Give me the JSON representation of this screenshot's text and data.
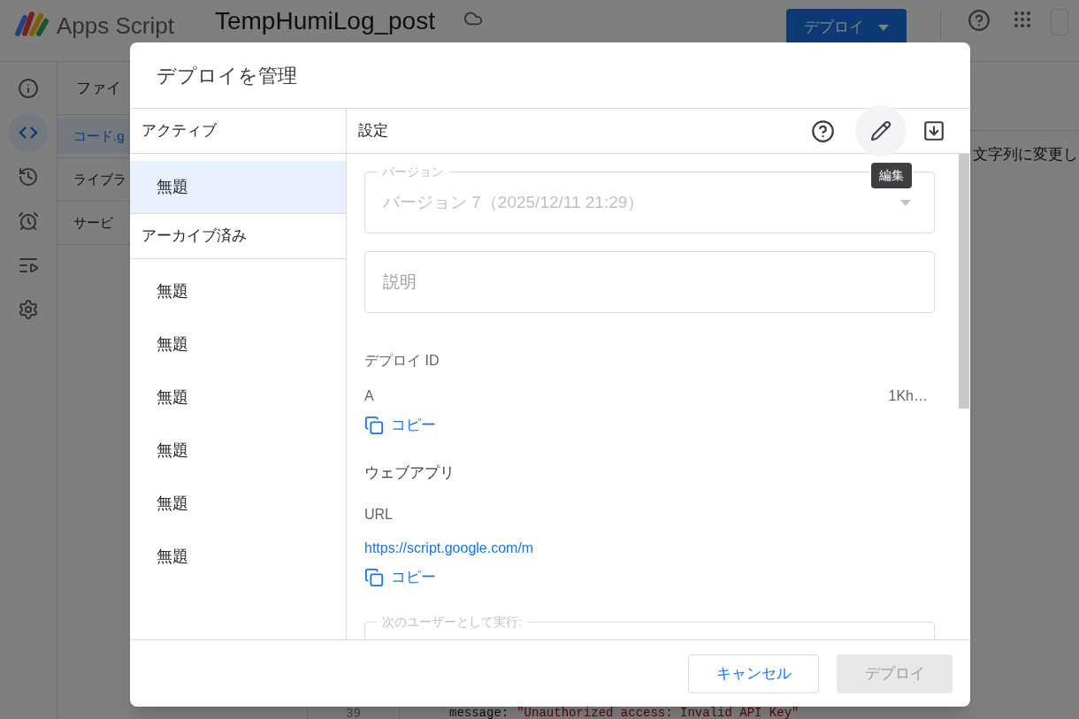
{
  "app_bar": {
    "product": "Apps Script",
    "project": "TempHumiLog_post",
    "deploy_button": "デプロイ"
  },
  "rail": [
    {
      "kind": "info",
      "selected": false
    },
    {
      "kind": "code",
      "selected": true
    },
    {
      "kind": "history",
      "selected": false
    },
    {
      "kind": "alarm",
      "selected": false
    },
    {
      "kind": "run",
      "selected": false
    },
    {
      "kind": "settings",
      "selected": false
    }
  ],
  "file_panel": {
    "heading": "ファイ",
    "items": [
      {
        "label": "コード.g",
        "selected": true
      },
      {
        "label": "ライブラ",
        "selected": false
      },
      {
        "label": "サービ",
        "selected": false
      }
    ]
  },
  "editor": {
    "text": "文字列に変更し",
    "line_number": "39",
    "code_key": "message:",
    "code_value": "\"Unauthorized access: Invalid API Key\""
  },
  "dialog": {
    "title": "デプロイを管理",
    "sections": [
      {
        "heading": "アクティブ",
        "items": [
          {
            "label": "無題",
            "selected": true
          }
        ]
      },
      {
        "heading": "アーカイブ済み",
        "items": [
          {
            "label": "無題",
            "selected": false
          },
          {
            "label": "無題",
            "selected": false
          },
          {
            "label": "無題",
            "selected": false
          },
          {
            "label": "無題",
            "selected": false
          },
          {
            "label": "無題",
            "selected": false
          },
          {
            "label": "無題",
            "selected": false
          }
        ]
      }
    ],
    "settings": {
      "heading": "設定",
      "tooltip": "編集",
      "version": {
        "label": "バージョン",
        "value": "バージョン 7（2025/12/11 21:29）",
        "disabled": true
      },
      "description": {
        "placeholder": "説明"
      },
      "deploy_id": {
        "label": "デプロイ ID",
        "value_start": "A",
        "value_end": "1Kh…",
        "copy": "コピー"
      },
      "web_app": {
        "heading": "ウェブアプリ",
        "url_label": "URL",
        "url": "https://script.google.com/m",
        "copy": "コピー"
      },
      "execute_as": {
        "label": "次のユーザーとして実行:"
      }
    },
    "buttons": [
      {
        "label": "キャンセル",
        "kind": "outlined"
      },
      {
        "label": "デプロイ",
        "kind": "disabled"
      }
    ]
  }
}
